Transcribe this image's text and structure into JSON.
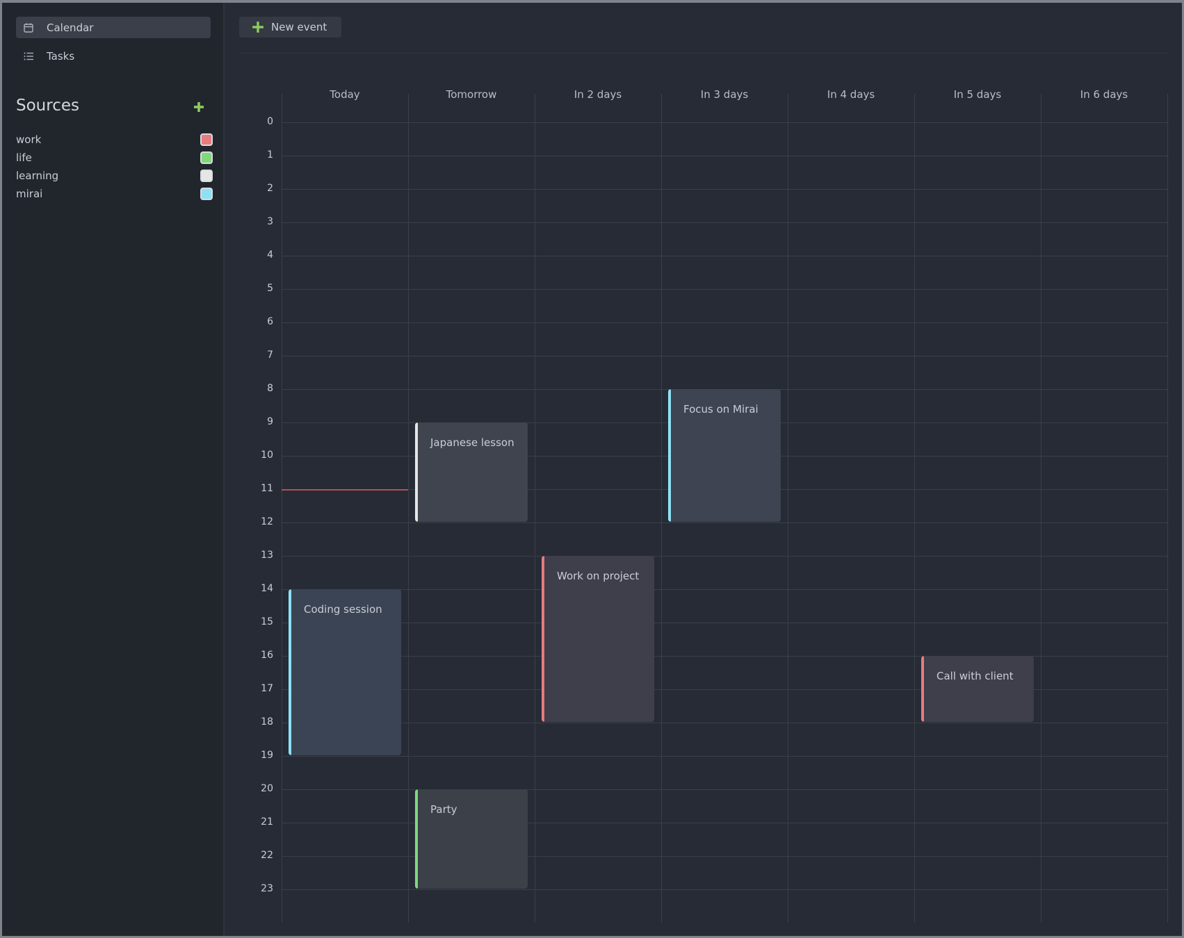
{
  "nav": [
    {
      "label": "Calendar",
      "icon": "calendar-icon",
      "active": true
    },
    {
      "label": "Tasks",
      "icon": "list-icon",
      "active": false
    }
  ],
  "sources": {
    "title": "Sources",
    "add_icon": "plus-icon",
    "items": [
      {
        "name": "work",
        "color": "#e77b7e"
      },
      {
        "name": "life",
        "color": "#7fd97b"
      },
      {
        "name": "learning",
        "color": "#e6e6e6"
      },
      {
        "name": "mirai",
        "color": "#8ee0f5"
      }
    ]
  },
  "toolbar": {
    "new_event_label": "New event",
    "new_event_icon": "plus-icon"
  },
  "calendar": {
    "days": [
      "Today",
      "Tomorrow",
      "In 2 days",
      "In 3 days",
      "In 4 days",
      "In 5 days",
      "In 6 days"
    ],
    "hours": [
      "0",
      "1",
      "2",
      "3",
      "4",
      "5",
      "6",
      "7",
      "8",
      "9",
      "10",
      "11",
      "12",
      "13",
      "14",
      "15",
      "16",
      "17",
      "18",
      "19",
      "20",
      "21",
      "22",
      "23"
    ],
    "now": {
      "day": 0,
      "hour": 11
    },
    "now_color": "#b05058",
    "events": [
      {
        "title": "Japanese lesson",
        "day": 1,
        "start": 9,
        "end": 12,
        "source": "learning",
        "color": "#e6e6e6",
        "bg": "#3f444f"
      },
      {
        "title": "Focus on Mirai",
        "day": 3,
        "start": 8,
        "end": 12,
        "source": "mirai",
        "color": "#8ee0f5",
        "bg": "#3e4451"
      },
      {
        "title": "Work on project",
        "day": 2,
        "start": 13,
        "end": 18,
        "source": "work",
        "color": "#e77b7e",
        "bg": "#3f3e4b"
      },
      {
        "title": "Coding session",
        "day": 0,
        "start": 14,
        "end": 19,
        "source": "mirai",
        "color": "#8ee0f5",
        "bg": "#3b4454"
      },
      {
        "title": "Call with client",
        "day": 5,
        "start": 16,
        "end": 18,
        "source": "work",
        "color": "#e77b7e",
        "bg": "#3f3e4b"
      },
      {
        "title": "Party",
        "day": 1,
        "start": 20,
        "end": 23,
        "source": "life",
        "color": "#7fd97b",
        "bg": "#3b4049"
      }
    ]
  }
}
